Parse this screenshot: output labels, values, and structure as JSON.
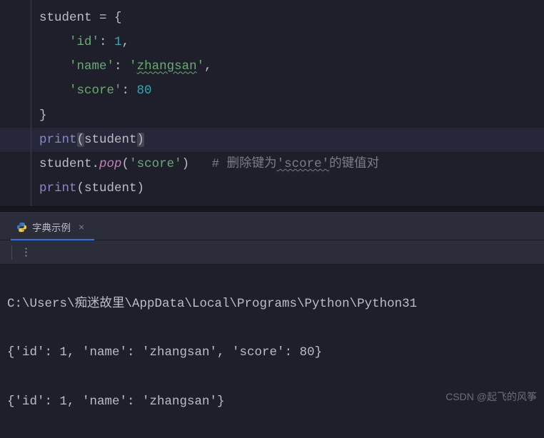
{
  "code": {
    "line1_var": "student",
    "line1_rest": " = {",
    "line2_pre": "    ",
    "line2_key": "'id'",
    "line2_sep": ": ",
    "line2_val": "1",
    "line2_end": ",",
    "line3_pre": "    ",
    "line3_key": "'name'",
    "line3_sep": ": ",
    "line3_q1": "'",
    "line3_val": "zhangsan",
    "line3_q2": "'",
    "line3_end": ",",
    "line4_pre": "    ",
    "line4_key": "'score'",
    "line4_sep": ": ",
    "line4_val": "80",
    "line5": "}",
    "line6_fn": "print",
    "line6_lp": "(",
    "line6_arg": "student",
    "line6_rp": ")",
    "line7_obj": "student",
    "line7_dot": ".",
    "line7_method": "pop",
    "line7_lp": "(",
    "line7_arg": "'score'",
    "line7_rp": ")",
    "line7_pad": "   ",
    "line7_hash": "# ",
    "line7_c1": "删除键为",
    "line7_cq": "'score'",
    "line7_c2": "的键值对",
    "line8_fn": "print",
    "line8_lp": "(",
    "line8_arg": "student",
    "line8_rp": ")"
  },
  "tab": {
    "label": "字典示例"
  },
  "console": {
    "line1": "C:\\Users\\痴迷故里\\AppData\\Local\\Programs\\Python\\Python31",
    "line2": "{'id': 1, 'name': 'zhangsan', 'score': 80}",
    "line3": "{'id': 1, 'name': 'zhangsan'}"
  },
  "watermark": "CSDN @起飞的风筝"
}
